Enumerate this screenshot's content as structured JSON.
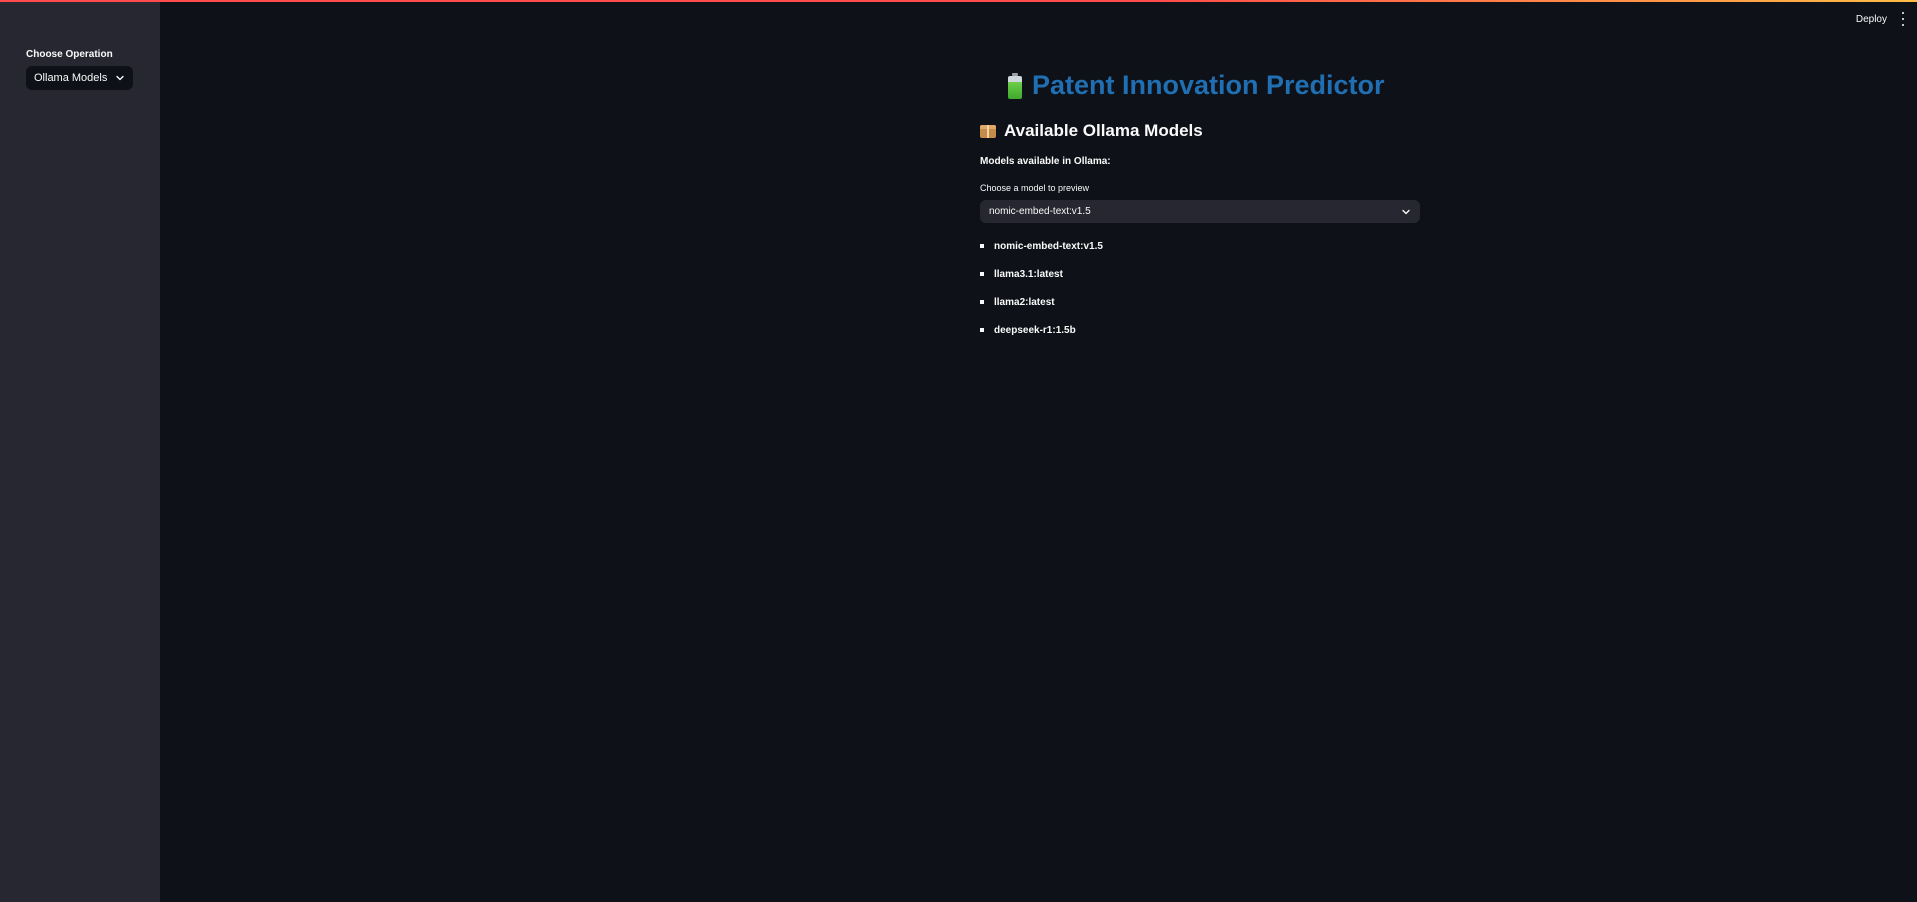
{
  "sidebar": {
    "label": "Choose Operation",
    "select_value": "Ollama Models"
  },
  "header": {
    "deploy_label": "Deploy"
  },
  "main": {
    "title": "Patent Innovation Predictor",
    "title_icon": "battery-icon",
    "subheader": "Available Ollama Models",
    "subheader_icon": "package-icon",
    "models_label": "Models available in Ollama:",
    "choose_label": "Choose a model to preview",
    "selected_model": "nomic-embed-text:v1.5",
    "models": [
      "nomic-embed-text:v1.5",
      "llama3.1:latest",
      "llama2:latest",
      "deepseek-r1:1.5b"
    ]
  },
  "colors": {
    "background": "#0e1117",
    "sidebar": "#262730",
    "title": "#1f6fb2",
    "accent_line": "#ff4b4b"
  }
}
